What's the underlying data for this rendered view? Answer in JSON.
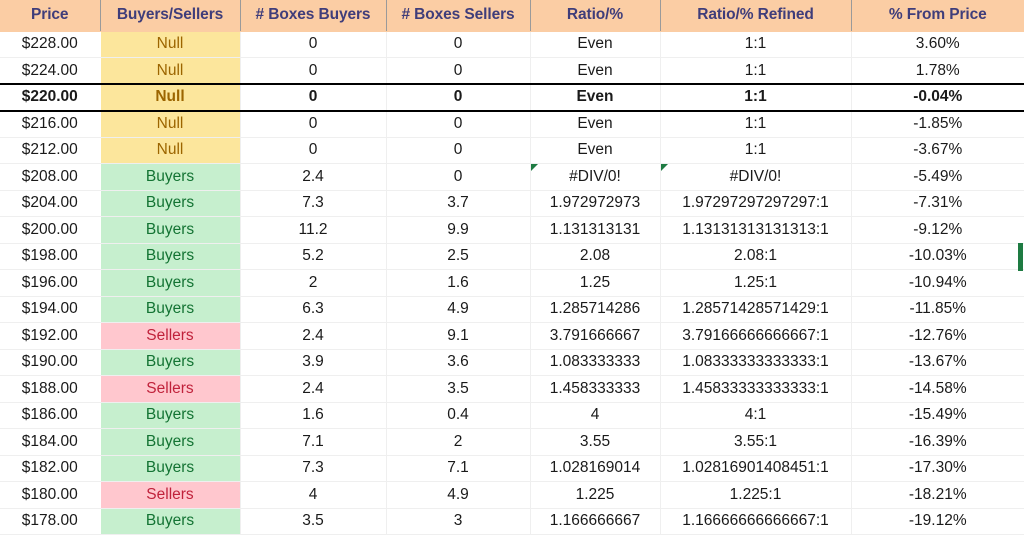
{
  "table": {
    "columns": [
      {
        "key": "price",
        "label": "Price"
      },
      {
        "key": "category",
        "label": "Buyers/Sellers"
      },
      {
        "key": "boxes_buy",
        "label": "# Boxes Buyers"
      },
      {
        "key": "boxes_sell",
        "label": "# Boxes Sellers"
      },
      {
        "key": "ratio",
        "label": "Ratio/%"
      },
      {
        "key": "ratio_ref",
        "label": "Ratio/% Refined"
      },
      {
        "key": "pct_price",
        "label": "% From Price"
      }
    ],
    "rows": [
      {
        "price": "$228.00",
        "category": "Null",
        "boxes_buy": "0",
        "boxes_sell": "0",
        "ratio": "Even",
        "ratio_ref": "1:1",
        "pct_price": "3.60%",
        "highlight": false,
        "error": false
      },
      {
        "price": "$224.00",
        "category": "Null",
        "boxes_buy": "0",
        "boxes_sell": "0",
        "ratio": "Even",
        "ratio_ref": "1:1",
        "pct_price": "1.78%",
        "highlight": false,
        "error": false
      },
      {
        "price": "$220.00",
        "category": "Null",
        "boxes_buy": "0",
        "boxes_sell": "0",
        "ratio": "Even",
        "ratio_ref": "1:1",
        "pct_price": "-0.04%",
        "highlight": true,
        "error": false
      },
      {
        "price": "$216.00",
        "category": "Null",
        "boxes_buy": "0",
        "boxes_sell": "0",
        "ratio": "Even",
        "ratio_ref": "1:1",
        "pct_price": "-1.85%",
        "highlight": false,
        "error": false
      },
      {
        "price": "$212.00",
        "category": "Null",
        "boxes_buy": "0",
        "boxes_sell": "0",
        "ratio": "Even",
        "ratio_ref": "1:1",
        "pct_price": "-3.67%",
        "highlight": false,
        "error": false
      },
      {
        "price": "$208.00",
        "category": "Buyers",
        "boxes_buy": "2.4",
        "boxes_sell": "0",
        "ratio": "#DIV/0!",
        "ratio_ref": "#DIV/0!",
        "pct_price": "-5.49%",
        "highlight": false,
        "error": true
      },
      {
        "price": "$204.00",
        "category": "Buyers",
        "boxes_buy": "7.3",
        "boxes_sell": "3.7",
        "ratio": "1.972972973",
        "ratio_ref": "1.97297297297297:1",
        "pct_price": "-7.31%",
        "highlight": false,
        "error": false
      },
      {
        "price": "$200.00",
        "category": "Buyers",
        "boxes_buy": "11.2",
        "boxes_sell": "9.9",
        "ratio": "1.131313131",
        "ratio_ref": "1.13131313131313:1",
        "pct_price": "-9.12%",
        "highlight": false,
        "error": false
      },
      {
        "price": "$198.00",
        "category": "Buyers",
        "boxes_buy": "5.2",
        "boxes_sell": "2.5",
        "ratio": "2.08",
        "ratio_ref": "2.08:1",
        "pct_price": "-10.03%",
        "highlight": false,
        "error": false
      },
      {
        "price": "$196.00",
        "category": "Buyers",
        "boxes_buy": "2",
        "boxes_sell": "1.6",
        "ratio": "1.25",
        "ratio_ref": "1.25:1",
        "pct_price": "-10.94%",
        "highlight": false,
        "error": false
      },
      {
        "price": "$194.00",
        "category": "Buyers",
        "boxes_buy": "6.3",
        "boxes_sell": "4.9",
        "ratio": "1.285714286",
        "ratio_ref": "1.28571428571429:1",
        "pct_price": "-11.85%",
        "highlight": false,
        "error": false
      },
      {
        "price": "$192.00",
        "category": "Sellers",
        "boxes_buy": "2.4",
        "boxes_sell": "9.1",
        "ratio": "3.791666667",
        "ratio_ref": "3.79166666666667:1",
        "pct_price": "-12.76%",
        "highlight": false,
        "error": false
      },
      {
        "price": "$190.00",
        "category": "Buyers",
        "boxes_buy": "3.9",
        "boxes_sell": "3.6",
        "ratio": "1.083333333",
        "ratio_ref": "1.08333333333333:1",
        "pct_price": "-13.67%",
        "highlight": false,
        "error": false
      },
      {
        "price": "$188.00",
        "category": "Sellers",
        "boxes_buy": "2.4",
        "boxes_sell": "3.5",
        "ratio": "1.458333333",
        "ratio_ref": "1.45833333333333:1",
        "pct_price": "-14.58%",
        "highlight": false,
        "error": false
      },
      {
        "price": "$186.00",
        "category": "Buyers",
        "boxes_buy": "1.6",
        "boxes_sell": "0.4",
        "ratio": "4",
        "ratio_ref": "4:1",
        "pct_price": "-15.49%",
        "highlight": false,
        "error": false
      },
      {
        "price": "$184.00",
        "category": "Buyers",
        "boxes_buy": "7.1",
        "boxes_sell": "2",
        "ratio": "3.55",
        "ratio_ref": "3.55:1",
        "pct_price": "-16.39%",
        "highlight": false,
        "error": false
      },
      {
        "price": "$182.00",
        "category": "Buyers",
        "boxes_buy": "7.3",
        "boxes_sell": "7.1",
        "ratio": "1.028169014",
        "ratio_ref": "1.02816901408451:1",
        "pct_price": "-17.30%",
        "highlight": false,
        "error": false
      },
      {
        "price": "$180.00",
        "category": "Sellers",
        "boxes_buy": "4",
        "boxes_sell": "4.9",
        "ratio": "1.225",
        "ratio_ref": "1.225:1",
        "pct_price": "-18.21%",
        "highlight": false,
        "error": false
      },
      {
        "price": "$178.00",
        "category": "Buyers",
        "boxes_buy": "3.5",
        "boxes_sell": "3",
        "ratio": "1.166666667",
        "ratio_ref": "1.16666666666667:1",
        "pct_price": "-19.12%",
        "highlight": false,
        "error": false
      }
    ]
  },
  "colors": {
    "header_bg": "#FBCDA4",
    "header_text": "#3F3D7A",
    "null_bg": "#FCE69C",
    "null_text": "#9C6500",
    "buyers_bg": "#C6EFCE",
    "buyers_text": "#137333",
    "sellers_bg": "#FFC7CE",
    "sellers_text": "#C0223B",
    "error_marker": "#1E7B42",
    "edge_marker": "#1E7B42"
  },
  "markers": {
    "error_triangle_name": "error-triangle-icon",
    "edge_marker_name": "right-edge-selection-marker"
  }
}
